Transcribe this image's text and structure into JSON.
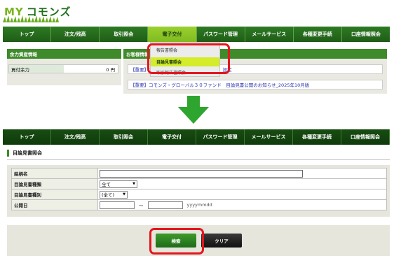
{
  "logo": {
    "my": "MY",
    "rest": "コモンズ"
  },
  "nav": [
    {
      "label": "トップ"
    },
    {
      "label": "注文/残高"
    },
    {
      "label": "取引照会"
    },
    {
      "label": "電子交付"
    },
    {
      "label": "パスワード管理"
    },
    {
      "label": "メールサービス"
    },
    {
      "label": "各種変更手続"
    },
    {
      "label": "口座情報照会"
    }
  ],
  "left_panel": {
    "title": "余力資産情報",
    "row_label": "買付余力",
    "row_value": "0 円"
  },
  "right_panel": {
    "title": "お客様情報",
    "news": [
      "【重要】コモンズ・グローバル30ファンド」設定",
      "【重要】コモンズ・グローバル３０ファンド　目論見書公開のお知らせ_2025年10月版"
    ]
  },
  "dropdown": {
    "items": [
      "報告書照会",
      "目論見書照会",
      "取引報告書照会"
    ],
    "selected_index": 1
  },
  "form": {
    "heading": "目論見書照会",
    "rows": {
      "issue_name": "銘柄名",
      "doc_kind": "目論見書種類",
      "doc_type": "目論見書種別",
      "publish_date": "公開日"
    },
    "doc_kind_value": "全て",
    "doc_type_value": "(全て)",
    "date_tilde": "〜",
    "date_hint": "yyyymmdd"
  },
  "buttons": {
    "search": "検索",
    "clear": "クリア"
  },
  "colors": {
    "accent": "#3f8a2b",
    "highlight": "#e3161d",
    "menu_selected": "#d4ec2a"
  }
}
